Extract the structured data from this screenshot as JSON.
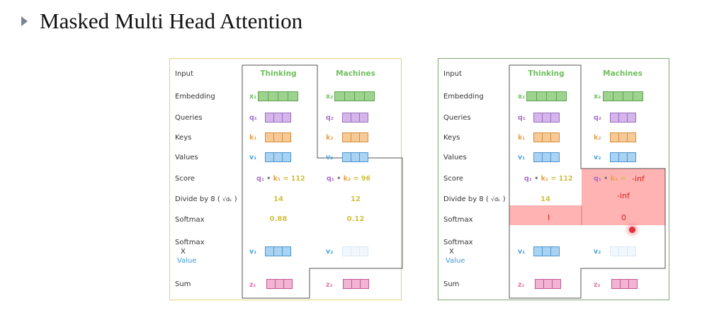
{
  "title": "Masked Multi Head Attention",
  "row_labels": {
    "input": "Input",
    "embedding": "Embedding",
    "queries": "Queries",
    "keys": "Keys",
    "values": "Values",
    "score": "Score",
    "divide": "Divide by 8 (",
    "divide_end": ")",
    "sqrt_dk": "√dₖ",
    "softmax": "Softmax",
    "softmax2": "Softmax",
    "x": "X",
    "value": "Value",
    "sum": "Sum"
  },
  "words": [
    "Thinking",
    "Machines"
  ],
  "symbols": {
    "x1": "x₁",
    "x2": "x₂",
    "q1": "q₁",
    "q2": "q₂",
    "k1": "k₁",
    "k2": "k₂",
    "v1": "v₁",
    "v2": "v₂",
    "z1": "z₁",
    "z2": "z₂",
    "dot": "•",
    "eq112": "= 112",
    "eq96": "= 96",
    "eq": "="
  },
  "left_panel": {
    "div1": "14",
    "div2": "12",
    "soft1": "0.88",
    "soft2": "0.12"
  },
  "right_panel": {
    "score_masked": "-inf",
    "div1": "14",
    "div_masked": "-inf",
    "soft1": "I",
    "soft2": "0"
  },
  "colors": {
    "left_border": "#e5d37a",
    "right_border": "#7fa874",
    "mask_red": "#ffb3b3",
    "word_green": "#6fbf5d"
  }
}
